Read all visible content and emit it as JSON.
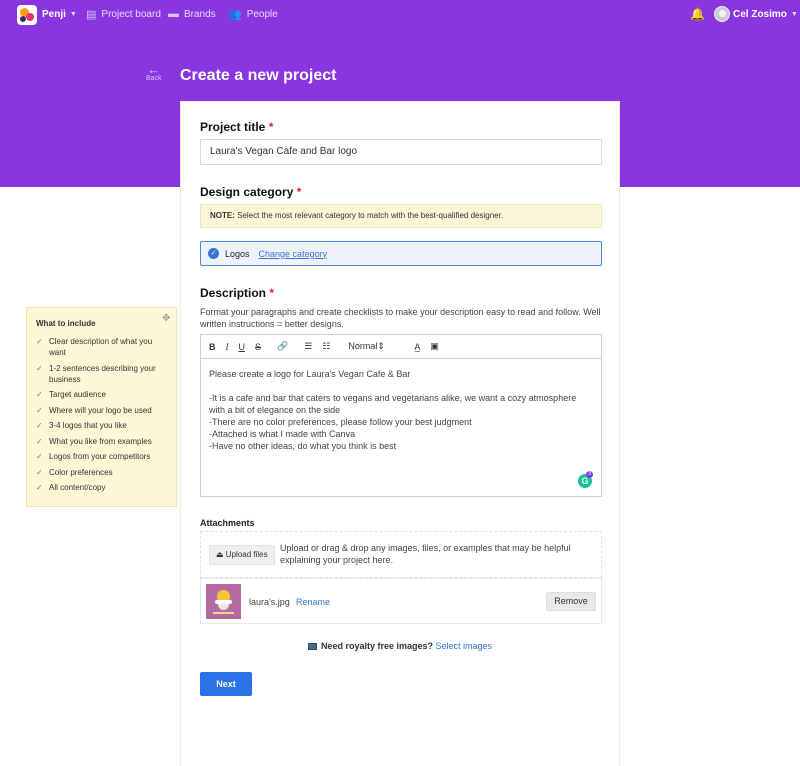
{
  "colors": {
    "accent": "#8a36e0",
    "primary_button": "#2b72e6",
    "link": "#3a74d0"
  },
  "nav": {
    "brand": "Penji",
    "links": [
      {
        "label": "Project board",
        "icon": "clipboard-icon"
      },
      {
        "label": "Brands",
        "icon": "folder-icon"
      },
      {
        "label": "People",
        "icon": "people-icon"
      }
    ],
    "user": "Cel Zosimo"
  },
  "header": {
    "back_label": "Back",
    "title": "Create a new project"
  },
  "form": {
    "project_title_label": "Project title",
    "project_title_value": "Laura's Vegan Cafe and Bar logo",
    "design_category_label": "Design category",
    "note_prefix": "NOTE:",
    "note_text": " Select the most relevant category to match with the best-qualified designer.",
    "selected_category": "Logos",
    "change_category": "Change category",
    "description_label": "Description",
    "description_help": "Format your paragraphs and create checklists to make your description easy to read and follow. Well written instructions = better designs.",
    "toolbar": {
      "bold": "B",
      "italic": "I",
      "underline": "U",
      "strike": "S",
      "format": "Normal"
    },
    "description_text": "Please create a logo for Laura's Vegan Cafe & Bar\n\n-It is a cafe and bar that caters to vegans and vegetarians alike, we want a cozy atmosphere with a bit of elegance on the side\n-There are no color preferences, please follow your best judgment\n-Attached is what I made with Canva\n-Have no other ideas, do what you think is best",
    "grammarly_count": "3",
    "attachments_label": "Attachments",
    "upload_button": "Upload files",
    "upload_text": "Upload or drag & drop any images, files, or examples that may be helpful explaining your project here.",
    "file": {
      "name": "laura's.jpg",
      "rename": "Rename",
      "remove": "Remove"
    },
    "royalty_text": "Need royalty free images?",
    "royalty_link": "Select images",
    "next_button": "Next"
  },
  "tips": {
    "title": "What to include",
    "items": [
      "Clear description of what you want",
      "1-2 sentences describing your business",
      "Target audience",
      "Where will your logo be used",
      "3-4 logos that you like",
      "What you like from examples",
      "Logos from your competitors",
      "Color preferences",
      "All content/copy"
    ]
  }
}
